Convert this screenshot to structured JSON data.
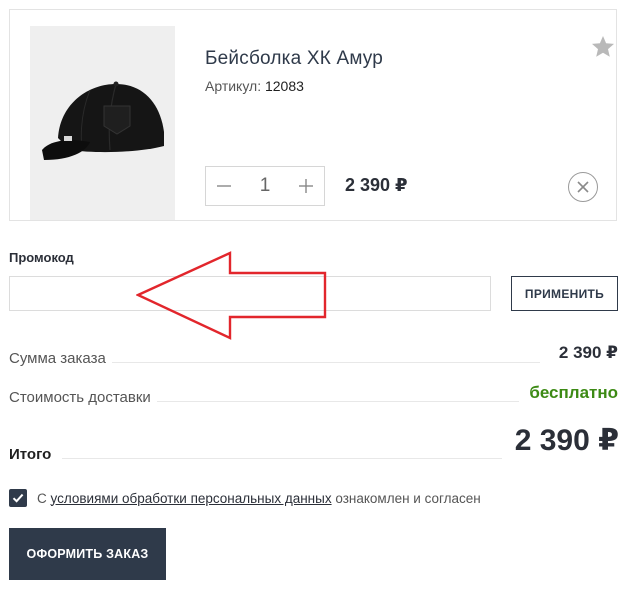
{
  "cart_item": {
    "title": "Бейсболка ХК Амур",
    "article_label": "Артикул:",
    "article_value": "12083",
    "quantity": "1",
    "price": "2 390 ₽",
    "image_alt": "black baseball cap"
  },
  "promo": {
    "label": "Промокод",
    "value": "",
    "placeholder": "",
    "apply_label": "ПРИМЕНИТЬ"
  },
  "summary": {
    "order_sum_label": "Сумма заказа",
    "order_sum_value": "2 390 ₽",
    "delivery_label": "Стоимость доставки",
    "delivery_value": "бесплатно",
    "total_label": "Итого",
    "total_value": "2 390 ₽"
  },
  "consent": {
    "checked": true,
    "prefix": "С ",
    "link_text": "условиями обработки персональных данных",
    "suffix": " ознакомлен и согласен"
  },
  "checkout": {
    "button_label": "ОФОРМИТЬ ЗАКАЗ"
  },
  "colors": {
    "accent": "#2f3a4a",
    "free": "#3c8a14",
    "arrow": "#e2262c"
  },
  "icons": {
    "favorite": "star-icon",
    "decrement": "minus-icon",
    "increment": "plus-icon",
    "remove": "close-icon",
    "checkbox": "checkmark-icon",
    "annotation": "arrow-left-icon"
  }
}
